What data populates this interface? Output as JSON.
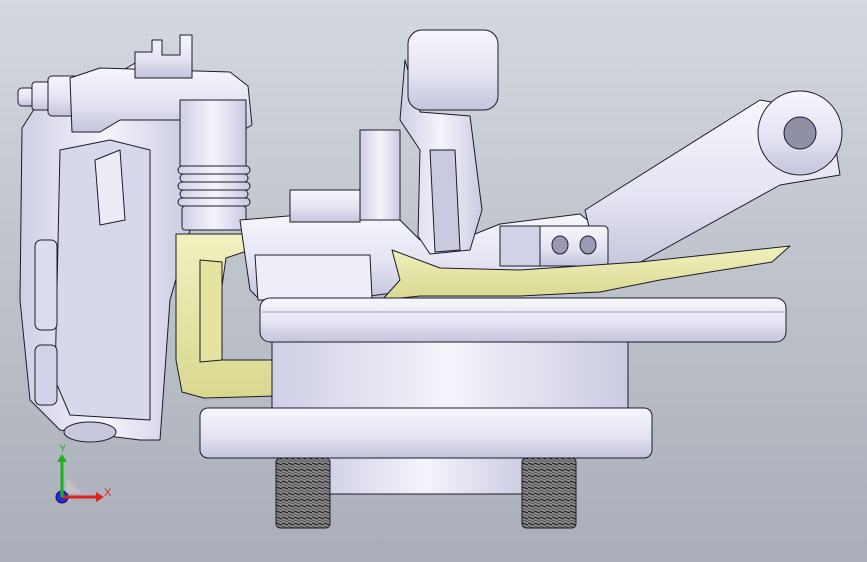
{
  "viewport": {
    "background_top": "#d4d8df",
    "background_bottom": "#a9aeb8"
  },
  "model": {
    "part_fill": "#e9e9f6",
    "part_shade": "#c9c9e0",
    "edge_color": "#1c1c28",
    "section_fill": "#e8e8a8",
    "section_shade": "#cfcf84",
    "thread_fill": "#6f6f6f"
  },
  "triad": {
    "x_label": "X",
    "y_label": "Y",
    "x_color": "#e02020",
    "y_color": "#20b020",
    "z_color": "#2030d0"
  }
}
